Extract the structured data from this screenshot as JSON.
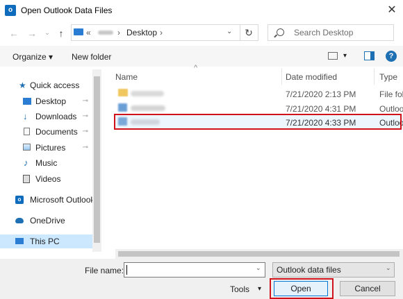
{
  "window": {
    "title": "Open Outlook Data Files",
    "close_glyph": "✕",
    "app_icon": "outlook-icon",
    "app_icon_letter": "o"
  },
  "nav": {
    "back_glyph": "←",
    "forward_glyph": "→",
    "recent_glyph": "⌄",
    "up_glyph": "↑",
    "path_prefix": "«",
    "path_sep1": "›",
    "path_current": "Desktop",
    "path_sep2": "›",
    "dropdown_glyph": "⌄",
    "refresh_glyph": "↻",
    "search_placeholder": "Search Desktop"
  },
  "toolbar": {
    "organize_label": "Organize ▾",
    "new_folder_label": "New folder",
    "view_dropdown_glyph": "▾",
    "help_glyph": "?"
  },
  "sidebar": {
    "items": [
      {
        "label": "Quick access",
        "icon": "star-icon",
        "pinned": false
      },
      {
        "label": "Desktop",
        "icon": "desktop-icon",
        "pinned": true
      },
      {
        "label": "Downloads",
        "icon": "downloads-icon",
        "pinned": true
      },
      {
        "label": "Documents",
        "icon": "documents-icon",
        "pinned": true
      },
      {
        "label": "Pictures",
        "icon": "pictures-icon",
        "pinned": true
      },
      {
        "label": "Music",
        "icon": "music-icon",
        "pinned": false
      },
      {
        "label": "Videos",
        "icon": "videos-icon",
        "pinned": false
      },
      {
        "label": "Microsoft Outlook",
        "icon": "outlook-icon",
        "pinned": false
      },
      {
        "label": "OneDrive",
        "icon": "cloud-icon",
        "pinned": false
      },
      {
        "label": "This PC",
        "icon": "pc-icon",
        "pinned": false
      }
    ],
    "pin_glyph": "📌"
  },
  "file_list": {
    "sort_glyph": "^",
    "columns": {
      "name": "Name",
      "date": "Date modified",
      "type": "Type"
    },
    "rows": [
      {
        "date": "7/21/2020 2:13 PM",
        "type": "File fol",
        "kind": "folder"
      },
      {
        "date": "7/21/2020 4:31 PM",
        "type": "Outlook",
        "kind": "pst"
      },
      {
        "date": "7/21/2020 4:33 PM",
        "type": "Outlook",
        "kind": "pst",
        "highlighted": true
      }
    ]
  },
  "footer": {
    "file_name_label": "File name:",
    "file_name_value": "",
    "file_type_value": "Outlook data files",
    "tools_label": "Tools",
    "tools_glyph": "▾",
    "select_glyph": "⌄",
    "open_label": "Open",
    "cancel_label": "Cancel"
  },
  "colors": {
    "highlight_border": "#d0121b",
    "accent": "#0078d7",
    "selected_bg": "#cce8ff"
  }
}
